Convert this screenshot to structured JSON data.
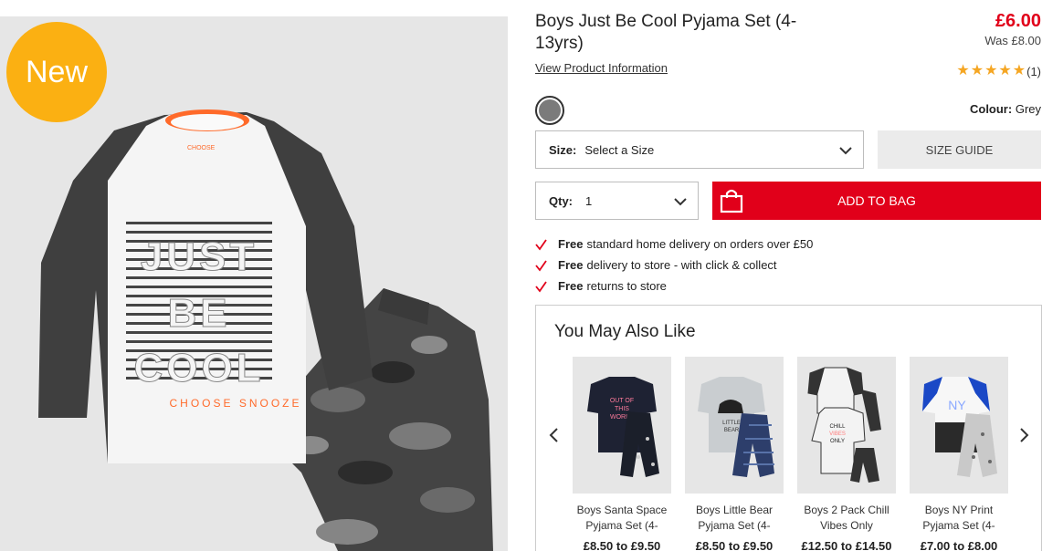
{
  "hero": {
    "badge": "New",
    "print_lines": [
      "JUST",
      "BE",
      "COOL"
    ],
    "slogan": "CHOOSE SNOOZE",
    "neck_label": "CHOOSE"
  },
  "product": {
    "title": "Boys Just Be Cool Pyjama Set (4-13yrs)",
    "price": "£6.00",
    "was_price": "Was £8.00",
    "view_info_link": "View Product Information",
    "rating_stars": 5,
    "review_count": "(1)",
    "colour_label": "Colour:",
    "colour_value": "Grey",
    "swatch_color": "#7b7b7b"
  },
  "size": {
    "label": "Size:",
    "value": "Select a Size"
  },
  "size_guide": "SIZE GUIDE",
  "qty": {
    "label": "Qty:",
    "value": "1"
  },
  "add_to_bag": "ADD TO BAG",
  "benefits": [
    {
      "bold": "Free",
      "text": "standard home delivery on orders over £50"
    },
    {
      "bold": "Free",
      "text": "delivery to store - with click & collect"
    },
    {
      "bold": "Free",
      "text": "returns to store"
    }
  ],
  "you_may_also_like": {
    "heading": "You May Also Like",
    "items": [
      {
        "name": "Boys Santa Space Pyjama Set (4-",
        "price": "£8.50 to £9.50",
        "tshirt_text": "OUT OF THIS WORLD"
      },
      {
        "name": "Boys Little Bear Pyjama Set (4-",
        "price": "£8.50 to £9.50",
        "tshirt_text": "LITTLE BEAR"
      },
      {
        "name": "Boys 2 Pack Chill Vibes Only",
        "price": "£12.50 to £14.50",
        "tshirt_text": "CHILL VIBES ONLY"
      },
      {
        "name": "Boys NY Print Pyjama Set (4-",
        "price": "£7.00 to £8.00",
        "tshirt_text": "NY"
      }
    ]
  },
  "colors": {
    "accent_red": "#e1001a",
    "badge_yellow": "#fbb012",
    "star": "#f5a623"
  }
}
